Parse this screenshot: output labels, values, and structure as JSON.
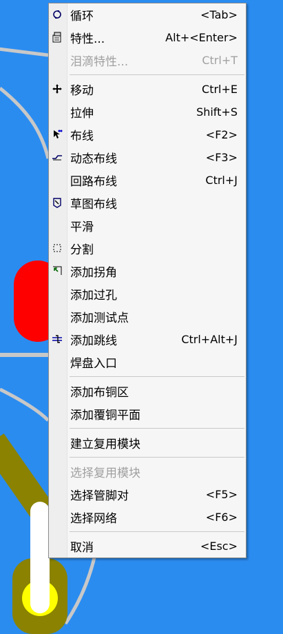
{
  "colors": {
    "background": "#2b8cf0",
    "trace_gray": "#c8c8c8",
    "pad_red": "#ff0000",
    "trace_olive": "#8a8200",
    "via_yellow": "#ffff00",
    "menu_bg": "#f6f6f6",
    "disabled_text": "#a0a0a0"
  },
  "menu": {
    "items": [
      {
        "type": "item",
        "label": "循环",
        "shortcut": "<Tab>",
        "icon": "cycle-icon",
        "disabled": false
      },
      {
        "type": "item",
        "label": "特性...",
        "shortcut": "Alt+<Enter>",
        "icon": "properties-icon",
        "disabled": false
      },
      {
        "type": "item",
        "label": "泪滴特性...",
        "shortcut": "Ctrl+T",
        "icon": "",
        "disabled": true
      },
      {
        "type": "sep"
      },
      {
        "type": "item",
        "label": "移动",
        "shortcut": "Ctrl+E",
        "icon": "move-icon",
        "disabled": false
      },
      {
        "type": "item",
        "label": "拉伸",
        "shortcut": "Shift+S",
        "icon": "",
        "disabled": false
      },
      {
        "type": "item",
        "label": "布线",
        "shortcut": "<F2>",
        "icon": "route-icon",
        "disabled": false
      },
      {
        "type": "item",
        "label": "动态布线",
        "shortcut": "<F3>",
        "icon": "dynamic-route-icon",
        "disabled": false
      },
      {
        "type": "item",
        "label": "回路布线",
        "shortcut": "Ctrl+J",
        "icon": "",
        "disabled": false
      },
      {
        "type": "item",
        "label": "草图布线",
        "shortcut": "",
        "icon": "sketch-route-icon",
        "disabled": false
      },
      {
        "type": "item",
        "label": "平滑",
        "shortcut": "",
        "icon": "",
        "disabled": false
      },
      {
        "type": "item",
        "label": "分割",
        "shortcut": "",
        "icon": "split-icon",
        "disabled": false
      },
      {
        "type": "item",
        "label": "添加拐角",
        "shortcut": "",
        "icon": "add-corner-icon",
        "disabled": false
      },
      {
        "type": "item",
        "label": "添加过孔",
        "shortcut": "",
        "icon": "",
        "disabled": false
      },
      {
        "type": "item",
        "label": "添加测试点",
        "shortcut": "",
        "icon": "",
        "disabled": false
      },
      {
        "type": "item",
        "label": "添加跳线",
        "shortcut": "Ctrl+Alt+J",
        "icon": "add-jumper-icon",
        "disabled": false
      },
      {
        "type": "item",
        "label": "焊盘入口",
        "shortcut": "",
        "icon": "",
        "disabled": false
      },
      {
        "type": "sep"
      },
      {
        "type": "item",
        "label": "添加布铜区",
        "shortcut": "",
        "icon": "",
        "disabled": false
      },
      {
        "type": "item",
        "label": "添加覆铜平面",
        "shortcut": "",
        "icon": "",
        "disabled": false
      },
      {
        "type": "sep"
      },
      {
        "type": "item",
        "label": "建立复用模块",
        "shortcut": "",
        "icon": "",
        "disabled": false
      },
      {
        "type": "sep"
      },
      {
        "type": "item",
        "label": "选择复用模块",
        "shortcut": "",
        "icon": "",
        "disabled": true
      },
      {
        "type": "item",
        "label": "选择管脚对",
        "shortcut": "<F5>",
        "icon": "",
        "disabled": false
      },
      {
        "type": "item",
        "label": "选择网络",
        "shortcut": "<F6>",
        "icon": "",
        "disabled": false
      },
      {
        "type": "sep"
      },
      {
        "type": "item",
        "label": "取消",
        "shortcut": "<Esc>",
        "icon": "",
        "disabled": false
      }
    ]
  }
}
